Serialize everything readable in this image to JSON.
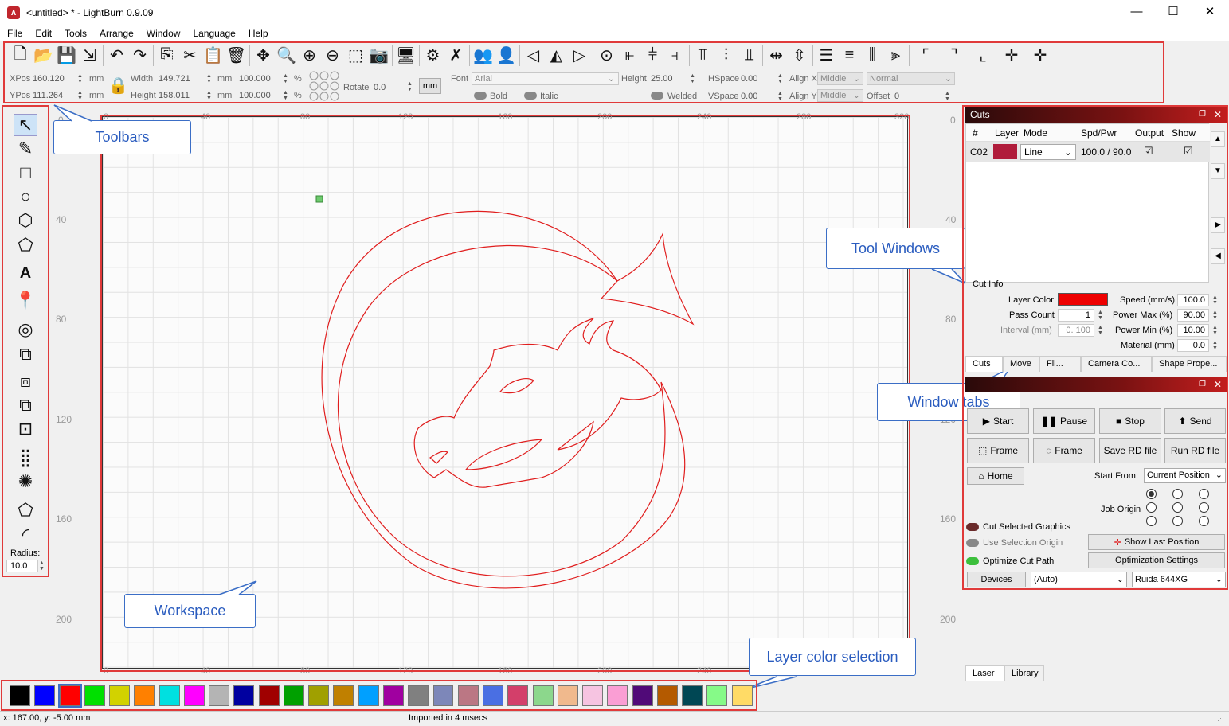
{
  "window": {
    "title": "<untitled> * - LightBurn 0.9.09",
    "minimize": "—",
    "maximize": "☐",
    "close": "✕"
  },
  "menu": [
    "File",
    "Edit",
    "Tools",
    "Arrange",
    "Window",
    "Language",
    "Help"
  ],
  "toolbar2": {
    "xpos_label": "XPos",
    "xpos": "160.120",
    "ypos_label": "YPos",
    "ypos": "111.264",
    "unit": "mm",
    "width_label": "Width",
    "width": "149.721",
    "height_label": "Height",
    "height": "158.011",
    "scale_w": "100.000",
    "scale_h": "100.000",
    "pct": "%",
    "rotate_label": "Rotate",
    "rotate": "0.0",
    "mm_button": "mm",
    "font_label": "Font",
    "font": "Arial",
    "font_height_label": "Height",
    "font_height": "25.00",
    "hspace_label": "HSpace",
    "hspace": "0.00",
    "vspace_label": "VSpace",
    "vspace": "0.00",
    "alignx_label": "Align X",
    "alignx": "Middle",
    "aligny_label": "Align Y",
    "aligny": "Middle",
    "normal": "Normal",
    "offset_label": "Offset",
    "offset": "0",
    "bold": "Bold",
    "italic": "Italic",
    "welded": "Welded"
  },
  "left_tools": {
    "radius_label": "Radius:",
    "radius": "10.0"
  },
  "rulers": {
    "top": [
      "0",
      "40",
      "80",
      "120",
      "160",
      "200",
      "240",
      "280",
      "320"
    ],
    "bottom": [
      "0",
      "40",
      "80",
      "120",
      "160",
      "200",
      "240"
    ],
    "left": [
      "0",
      "40",
      "80",
      "120",
      "160",
      "200"
    ],
    "right": [
      "0",
      "40",
      "80",
      "120",
      "160",
      "200"
    ]
  },
  "callouts": {
    "toolbars": "Toolbars",
    "workspace": "Workspace",
    "tool_windows": "Tool Windows",
    "window_tabs": "Window tabs",
    "layer_color": "Layer color selection"
  },
  "cuts": {
    "title": "Cuts",
    "headers": [
      "#",
      "Layer",
      "Mode",
      "Spd/Pwr",
      "Output",
      "Show"
    ],
    "row": {
      "num": "C02",
      "color": "#b01c3b",
      "mode": "Line",
      "spdpwr": "100.0 / 90.0"
    },
    "cut_info_title": "Cut Info",
    "layer_color_label": "Layer Color",
    "layer_color": "#ee0000",
    "pass_count_label": "Pass Count",
    "pass_count": "1",
    "interval_label": "Interval (mm)",
    "interval": "0. 100",
    "speed_label": "Speed (mm/s)",
    "speed": "100.0",
    "pmax_label": "Power Max (%)",
    "pmax": "90.00",
    "pmin_label": "Power Min (%)",
    "pmin": "10.00",
    "material_label": "Material (mm)",
    "material": "0.0"
  },
  "window_tabs": [
    "Cuts",
    "Move",
    "Fil...",
    "Camera Co...",
    "Shape Prope..."
  ],
  "laser": {
    "start": "Start",
    "pause": "Pause",
    "stop": "Stop",
    "send": "Send",
    "frame1": "Frame",
    "frame2": "Frame",
    "save_rd": "Save RD file",
    "run_rd": "Run RD file",
    "home": "Home",
    "start_from_label": "Start From:",
    "start_from": "Current Position",
    "job_origin_label": "Job Origin",
    "cut_selected": "Cut Selected Graphics",
    "use_selection": "Use Selection Origin",
    "optimize": "Optimize Cut Path",
    "show_last": "Show Last Position",
    "opt_settings": "Optimization Settings",
    "devices": "Devices",
    "auto": "(Auto)",
    "controller": "Ruida 644XG"
  },
  "bottom_tabs": [
    "Laser",
    "Library"
  ],
  "palette": [
    "#000000",
    "#0000ff",
    "#ff0000",
    "#00e000",
    "#d2d200",
    "#ff8000",
    "#00e0e0",
    "#ff00ff",
    "#b4b4b4",
    "#0000a0",
    "#a00000",
    "#00a000",
    "#a0a000",
    "#c08000",
    "#00a0ff",
    "#a000a0",
    "#808080",
    "#7d87b9",
    "#bb7784",
    "#4a6fe3",
    "#d33f6a",
    "#8cd78c",
    "#f0b98d",
    "#f6c4e1",
    "#fa9ed4",
    "#500a78",
    "#b45a00",
    "#004754",
    "#86fa88",
    "#ffdb66"
  ],
  "status": {
    "coords": "x: 167.00, y: -5.00 mm",
    "message": "Imported in 4 msecs"
  }
}
